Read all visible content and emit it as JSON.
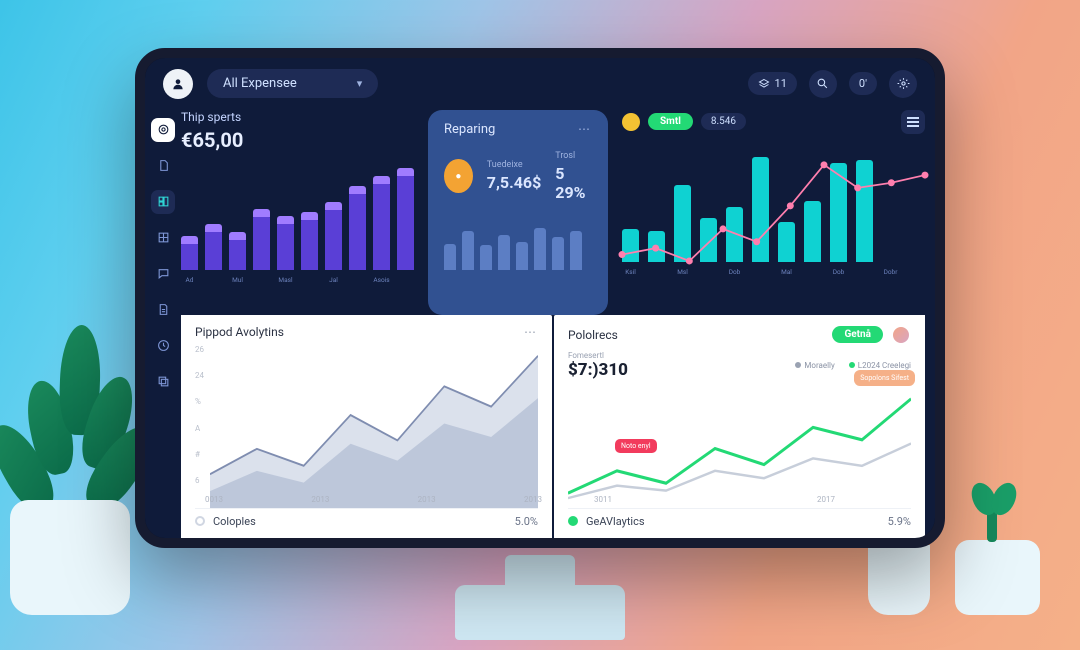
{
  "topbar": {
    "dropdown_label": "All Expensee",
    "pill_count": "11",
    "notif": "0'"
  },
  "sidebar_icons": [
    "target",
    "doc",
    "dash",
    "grid",
    "chat",
    "file",
    "clock",
    "copy"
  ],
  "card1": {
    "title": "Thip sperts",
    "amount": "€65,00",
    "x": [
      "Ad",
      "Mul",
      "Masl",
      "Jal",
      "Asois"
    ]
  },
  "card2": {
    "title": "Reparing",
    "metric1_label": "Tuedeixe",
    "metric1_value": "7,5.46$",
    "metric2_label": "Trosl",
    "metric2_value": "5 29%"
  },
  "card3": {
    "chip_green": "Smtl",
    "chip_value": "8.546",
    "x": [
      "Ksil",
      "Msl",
      "Dob",
      "Mal",
      "Dob",
      "Dobr"
    ]
  },
  "an": {
    "title": "Pippod Avolytins",
    "y": [
      "26",
      "24",
      "%",
      "A",
      "#",
      "6"
    ],
    "x": [
      "0013",
      "2013",
      "2013",
      "2013"
    ],
    "foot_label": "Coloples",
    "foot_value": "5.0%"
  },
  "po": {
    "title": "Pololrecs",
    "action": "Getnå",
    "sub_label": "Fomesertl",
    "big": "$7:)310",
    "leg_a": "Moraelly",
    "leg_b_label": "L2024",
    "leg_b_sub": "Creelegi",
    "badge": "Sopolons\nSifest",
    "tag": "Noto enyl",
    "x": [
      "3011",
      "2017"
    ],
    "foot_label": "GeAVlaytics",
    "foot_value": "5.9%"
  },
  "chart_data": [
    {
      "id": "card1_bars",
      "type": "bar",
      "title": "Thip sperts",
      "categories": [
        "Ad",
        "",
        "Mul",
        "",
        "Masl",
        "",
        "Jal",
        "",
        "",
        "Asois"
      ],
      "values": [
        28,
        40,
        32,
        55,
        48,
        52,
        62,
        78,
        88,
        96
      ],
      "ylim": [
        0,
        100
      ]
    },
    {
      "id": "card2_mini",
      "type": "bar",
      "categories": [
        "a",
        "b",
        "c",
        "d",
        "e",
        "f",
        "g",
        "h"
      ],
      "values": [
        30,
        45,
        28,
        40,
        32,
        48,
        38,
        44
      ],
      "ylim": [
        0,
        60
      ]
    },
    {
      "id": "card3_combo",
      "type": "bar",
      "categories": [
        "Ksil",
        "",
        "Msl",
        "",
        "Dob",
        "",
        "Mal",
        "",
        "Dob",
        "Dobr"
      ],
      "values": [
        30,
        28,
        70,
        40,
        50,
        95,
        36,
        55,
        90,
        92
      ],
      "series": [
        {
          "name": "line",
          "type": "line",
          "values": [
            20,
            25,
            15,
            40,
            30,
            58,
            90,
            72,
            76,
            82
          ]
        }
      ],
      "ylim": [
        0,
        100
      ]
    },
    {
      "id": "analytics_area",
      "type": "area",
      "title": "Pippod Avolytins",
      "x": [
        "0013",
        "2013",
        "2013",
        "2013"
      ],
      "series": [
        {
          "name": "a",
          "values": [
            20,
            35,
            25,
            55,
            40,
            72,
            60,
            90
          ]
        },
        {
          "name": "b",
          "values": [
            10,
            22,
            15,
            38,
            28,
            50,
            42,
            65
          ]
        }
      ],
      "ylim": [
        0,
        100
      ]
    },
    {
      "id": "politics_line",
      "type": "line",
      "title": "Pololrecs",
      "x": [
        "3011",
        "",
        "2017",
        ""
      ],
      "series": [
        {
          "name": "green",
          "values": [
            12,
            30,
            20,
            48,
            35,
            65,
            55,
            88
          ]
        },
        {
          "name": "grey",
          "values": [
            8,
            18,
            14,
            30,
            24,
            40,
            34,
            52
          ]
        }
      ],
      "ylim": [
        0,
        100
      ]
    }
  ]
}
